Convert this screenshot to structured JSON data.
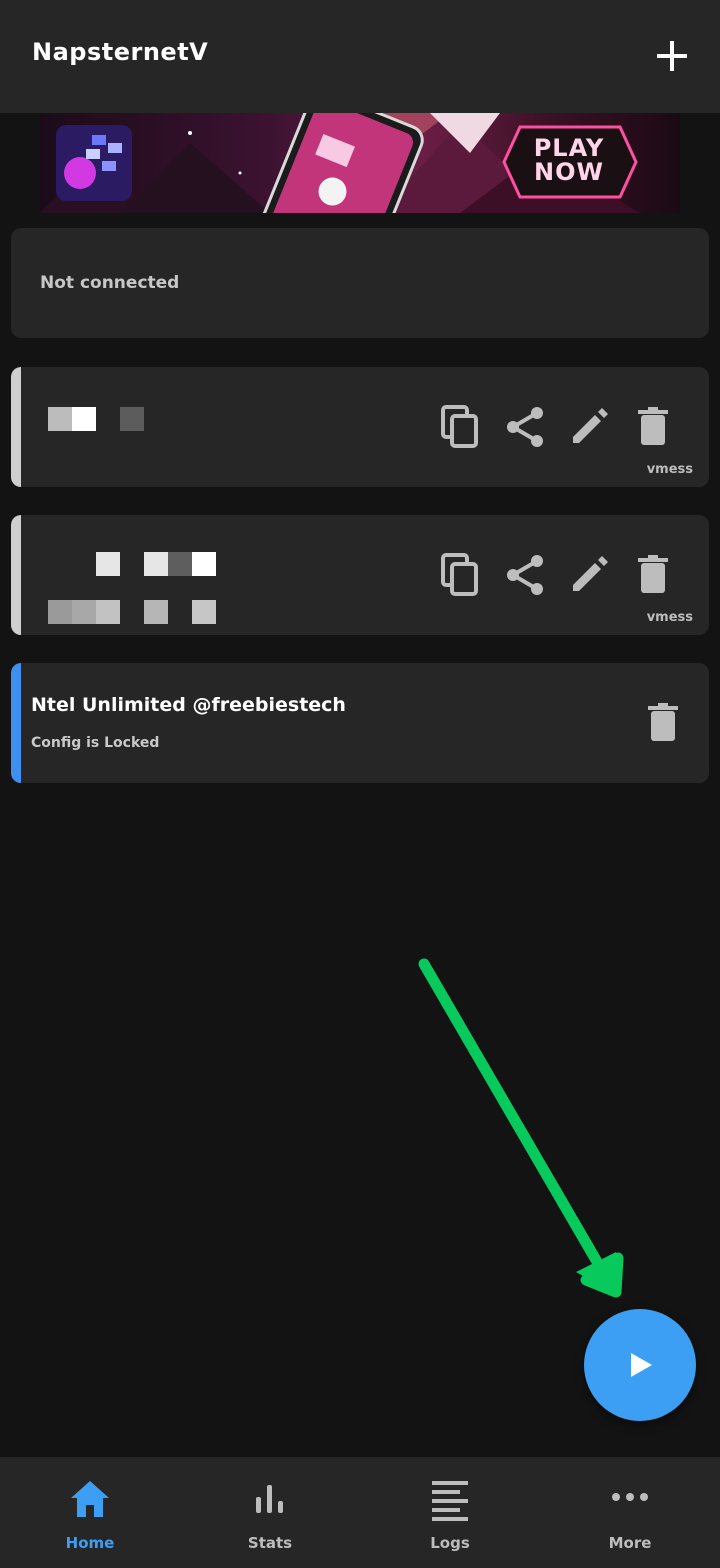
{
  "app": {
    "title": "NapsternetV",
    "add_icon": "plus-icon"
  },
  "ad": {
    "cta_line1": "PLAY",
    "cta_line2": "NOW"
  },
  "status": {
    "text": "Not connected"
  },
  "configs": [
    {
      "protocol": "vmess",
      "actions": [
        "copy-icon",
        "share-icon",
        "edit-icon",
        "delete-icon"
      ]
    },
    {
      "protocol": "vmess",
      "actions": [
        "copy-icon",
        "share-icon",
        "edit-icon",
        "delete-icon"
      ]
    },
    {
      "name": "Ntel Unlimited @freebiestech",
      "subtitle": "Config is Locked",
      "actions": [
        "delete-icon"
      ]
    }
  ],
  "fab": {
    "icon": "play-icon"
  },
  "colors": {
    "accent": "#3d9ff3",
    "surface": "#262626",
    "background": "#131313",
    "annotation_arrow": "#08c95c"
  },
  "nav": [
    {
      "label": "Home",
      "icon": "home-icon",
      "active": true
    },
    {
      "label": "Stats",
      "icon": "stats-icon",
      "active": false
    },
    {
      "label": "Logs",
      "icon": "logs-icon",
      "active": false
    },
    {
      "label": "More",
      "icon": "more-icon",
      "active": false
    }
  ]
}
